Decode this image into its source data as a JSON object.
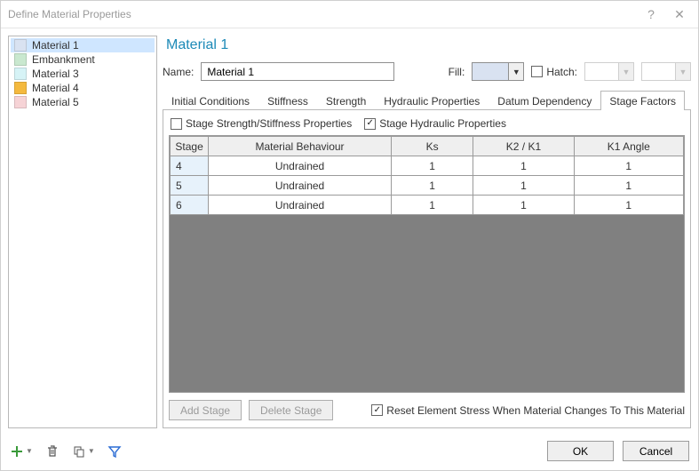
{
  "window": {
    "title": "Define Material Properties"
  },
  "sidebar": {
    "materials": [
      {
        "label": "Material 1",
        "color": "#d9e2f1",
        "selected": true
      },
      {
        "label": "Embankment",
        "color": "#c9e8cf",
        "selected": false
      },
      {
        "label": "Material 3",
        "color": "#d6f3f6",
        "selected": false
      },
      {
        "label": "Material 4",
        "color": "#f4b93e",
        "selected": false
      },
      {
        "label": "Material 5",
        "color": "#f6d3d6",
        "selected": false
      }
    ]
  },
  "main": {
    "heading": "Material 1",
    "name_label": "Name:",
    "name_value": "Material 1",
    "fill_label": "Fill:",
    "hatch_label": "Hatch:",
    "hatch_checked": false,
    "tabs": {
      "items": [
        "Initial Conditions",
        "Stiffness",
        "Strength",
        "Hydraulic Properties",
        "Datum Dependency",
        "Stage Factors"
      ],
      "active_index": 5
    },
    "stage_factors": {
      "stage_strength_label": "Stage Strength/Stiffness Properties",
      "stage_strength_checked": false,
      "stage_hydraulic_label": "Stage Hydraulic Properties",
      "stage_hydraulic_checked": true,
      "columns": [
        "Stage",
        "Material Behaviour",
        "Ks",
        "K2 / K1",
        "K1 Angle"
      ],
      "rows": [
        {
          "stage": "4",
          "behaviour": "Undrained",
          "ks": "1",
          "k2k1": "1",
          "k1a": "1"
        },
        {
          "stage": "5",
          "behaviour": "Undrained",
          "ks": "1",
          "k2k1": "1",
          "k1a": "1"
        },
        {
          "stage": "6",
          "behaviour": "Undrained",
          "ks": "1",
          "k2k1": "1",
          "k1a": "1"
        }
      ],
      "add_stage_label": "Add Stage",
      "delete_stage_label": "Delete Stage",
      "reset_label": "Reset Element Stress When Material Changes To This Material",
      "reset_checked": true
    }
  },
  "footer": {
    "ok": "OK",
    "cancel": "Cancel"
  }
}
